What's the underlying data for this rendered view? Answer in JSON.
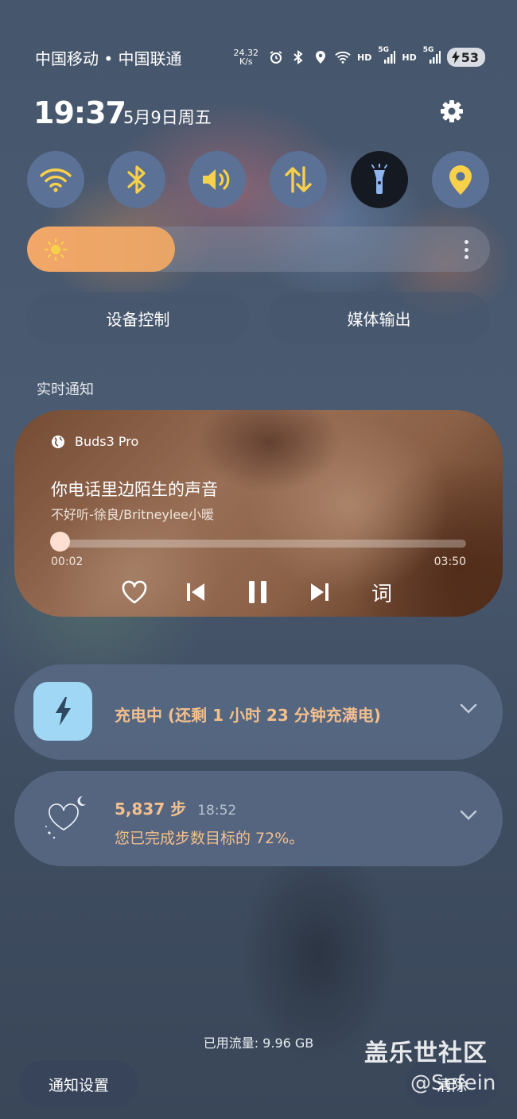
{
  "status_bar": {
    "carrier": "中国移动 • 中国联通",
    "net_speed_value": "24.32",
    "net_speed_unit": "K/s",
    "hd1": "HD",
    "hd2": "HD",
    "fiveg1": "5G",
    "fiveg2": "5G",
    "battery": "53"
  },
  "header": {
    "time": "19:37",
    "date": "5月9日周五"
  },
  "quick_tiles": [
    {
      "name": "wifi",
      "active": true
    },
    {
      "name": "bluetooth",
      "active": true
    },
    {
      "name": "sound",
      "active": true
    },
    {
      "name": "mobile-data",
      "active": true
    },
    {
      "name": "flashlight",
      "active": false
    },
    {
      "name": "location",
      "active": true
    }
  ],
  "brightness": {
    "level": 0.32
  },
  "buttons": {
    "device_control": "设备控制",
    "media_output": "媒体输出"
  },
  "live_section_label": "实时通知",
  "media": {
    "device": "Buds3 Pro",
    "title": "你电话里边陌生的声音",
    "artist": "不好听-徐良/Britneylee小暖",
    "position": "00:02",
    "duration": "03:50",
    "progress": 0.01,
    "lyrics_label": "词"
  },
  "charging": {
    "text": "充电中 (还剩 1 小时 23 分钟充满电)"
  },
  "steps": {
    "count": "5,837 步",
    "time": "18:52",
    "message": "您已完成步数目标的 72%。"
  },
  "footer": {
    "data_used": "已用流量: 9.96 GB",
    "notification_settings": "通知设置",
    "clear": "清除"
  },
  "watermark": {
    "line1": "盖乐世社区",
    "line2": "@Sefein"
  },
  "colors": {
    "tile_blue": "#5b7196",
    "icon_yellow": "#f8d04a",
    "accent_orange": "#f3c08d",
    "brightness_fill": "#f2a768"
  }
}
